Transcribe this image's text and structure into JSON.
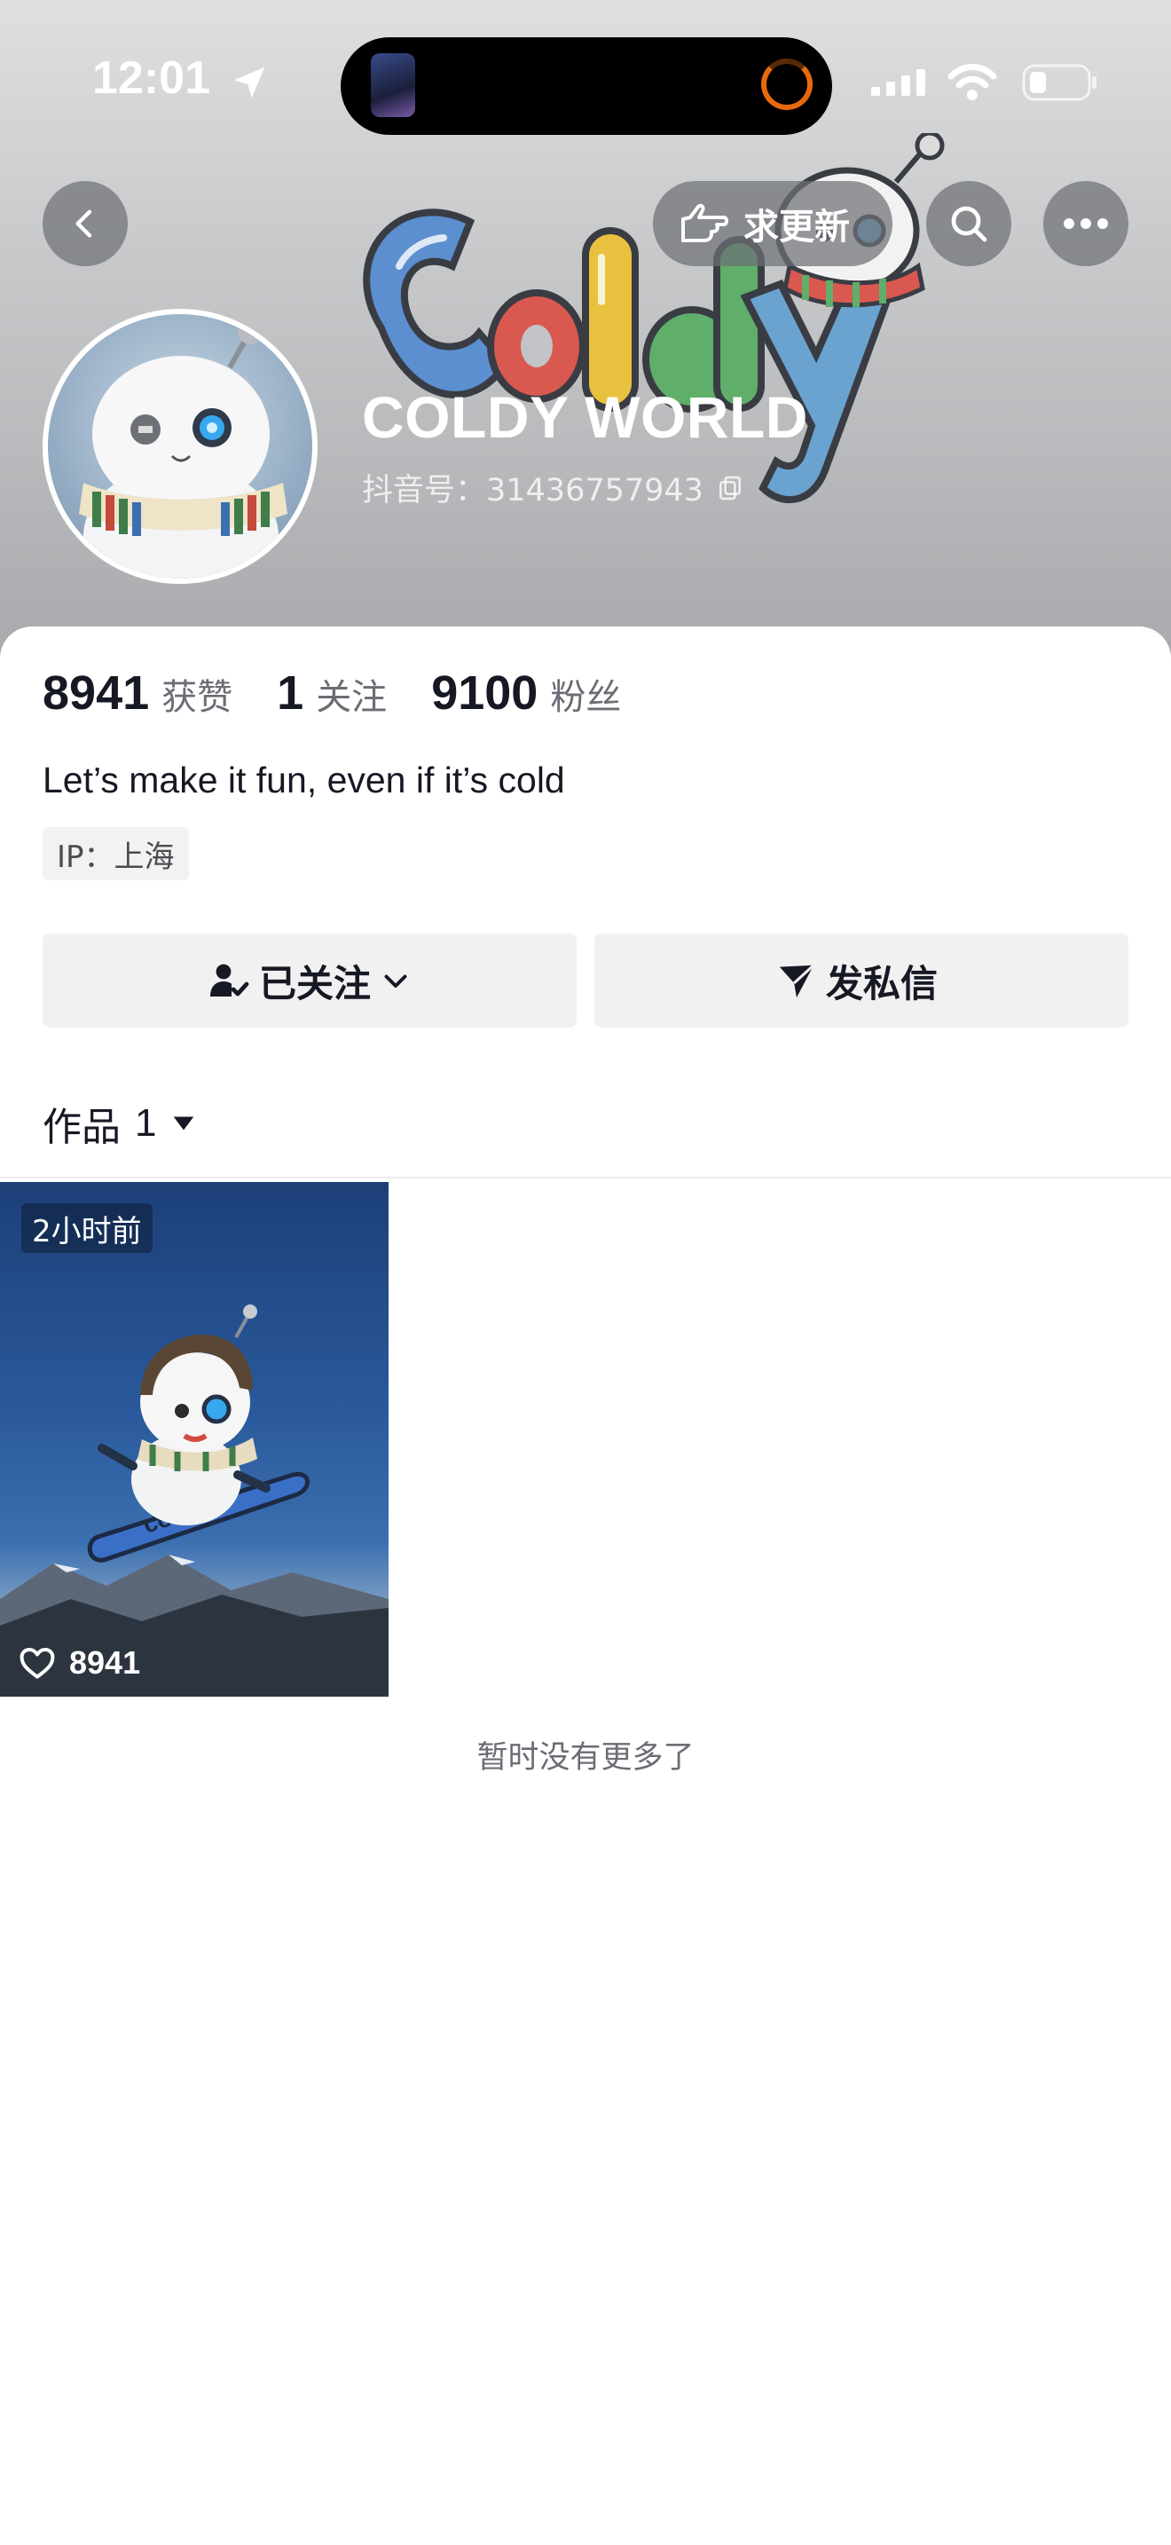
{
  "status_bar": {
    "time": "12:01"
  },
  "header": {
    "request_update_label": "求更新"
  },
  "profile": {
    "name": "COLDY WORLD",
    "douyin_id": "抖音号：31436757943",
    "likes_count": "8941",
    "likes_label": "获赞",
    "following_count": "1",
    "following_label": "关注",
    "followers_count": "9100",
    "followers_label": "粉丝",
    "bio": "Let’s make it fun, even if it’s cold",
    "ip_location": "IP：上海"
  },
  "actions": {
    "followed_label": "已关注",
    "message_label": "发私信"
  },
  "works": {
    "tab_label": "作品",
    "count": "1",
    "items": [
      {
        "time_badge": "2小时前",
        "likes": "8941"
      }
    ],
    "end_text": "暂时没有更多了"
  },
  "icons": [
    "back-icon",
    "pointing-hand-icon",
    "search-icon",
    "more-icon",
    "copy-icon",
    "follow-check-icon",
    "chevron-down-icon",
    "send-icon",
    "triangle-down-icon",
    "heart-icon"
  ]
}
